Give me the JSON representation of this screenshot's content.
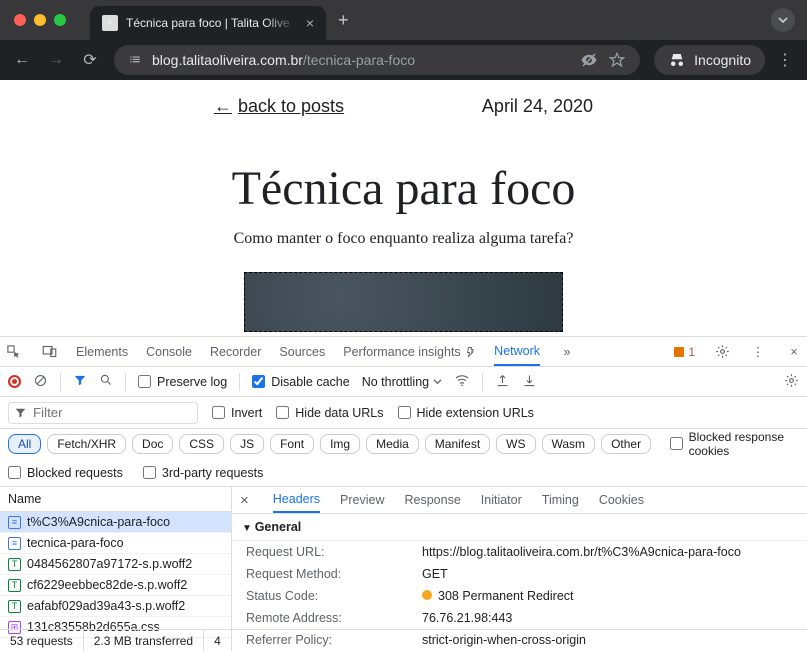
{
  "browser": {
    "tab_title": "Técnica para foco | Talita Olive",
    "url_host": "blog.talitaoliveira.com.br",
    "url_path": "/tecnica-para-foco",
    "incognito": "Incognito"
  },
  "page": {
    "back_label": "back to posts",
    "date": "April 24, 2020",
    "title": "Técnica para foco",
    "subtitle": "Como manter o foco enquanto realiza alguma tarefa?"
  },
  "devtools": {
    "tabs": {
      "elements": "Elements",
      "console": "Console",
      "recorder": "Recorder",
      "sources": "Sources",
      "perf": "Performance insights",
      "network": "Network"
    },
    "warn_count": "1",
    "preserve_log": "Preserve log",
    "disable_cache": "Disable cache",
    "throttling": "No throttling",
    "filter_ph": "Filter",
    "invert": "Invert",
    "hide_data": "Hide data URLs",
    "hide_ext": "Hide extension URLs",
    "chips": {
      "all": "All",
      "fetch": "Fetch/XHR",
      "doc": "Doc",
      "css": "CSS",
      "js": "JS",
      "font": "Font",
      "img": "Img",
      "media": "Media",
      "manifest": "Manifest",
      "ws": "WS",
      "wasm": "Wasm",
      "other": "Other"
    },
    "blocked_cookies": "Blocked response cookies",
    "blocked_req": "Blocked requests",
    "third_party": "3rd-party requests",
    "name_col": "Name",
    "requests": [
      {
        "icon": "doc",
        "name": "t%C3%A9cnica-para-foco",
        "sel": true
      },
      {
        "icon": "doc",
        "name": "tecnica-para-foco"
      },
      {
        "icon": "font",
        "name": "0484562807a97172-s.p.woff2"
      },
      {
        "icon": "font",
        "name": "cf6229eebbec82de-s.p.woff2"
      },
      {
        "icon": "font",
        "name": "eafabf029ad39a43-s.p.woff2"
      },
      {
        "icon": "css",
        "name": "131c83558b2d655a.css"
      }
    ],
    "detail_tabs": {
      "headers": "Headers",
      "preview": "Preview",
      "response": "Response",
      "initiator": "Initiator",
      "timing": "Timing",
      "cookies": "Cookies"
    },
    "general": "General",
    "kv": {
      "url_k": "Request URL:",
      "url_v": "https://blog.talitaoliveira.com.br/t%C3%A9cnica-para-foco",
      "method_k": "Request Method:",
      "method_v": "GET",
      "status_k": "Status Code:",
      "status_v": "308 Permanent Redirect",
      "remote_k": "Remote Address:",
      "remote_v": "76.76.21.98:443",
      "ref_k": "Referrer Policy:",
      "ref_v": "strict-origin-when-cross-origin"
    },
    "status": {
      "reqs": "53 requests",
      "xfer": "2.3 MB transferred",
      "more": "4"
    }
  }
}
